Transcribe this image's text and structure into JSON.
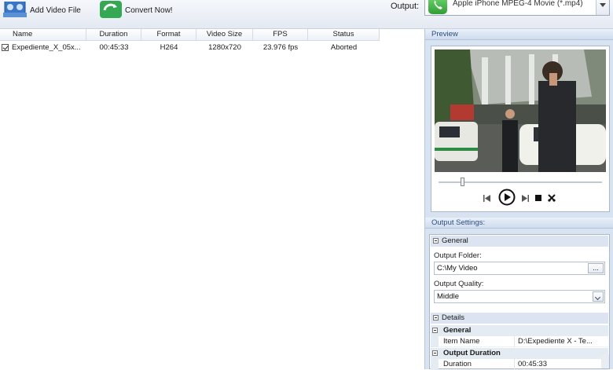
{
  "toolbar": {
    "add_video_label": "Add Video File",
    "convert_label": "Convert Now!",
    "output_label": "Output:",
    "output_value": "Apple iPhone MPEG-4 Movie (*.mp4)"
  },
  "file_list": {
    "columns": [
      "Name",
      "Duration",
      "Format",
      "Video Size",
      "FPS",
      "Status"
    ],
    "rows": [
      {
        "checked": true,
        "name": "Expediente_X_05x...",
        "duration": "00:45:33",
        "format": "H264",
        "video_size": "1280x720",
        "fps": "23.976 fps",
        "status": "Aborted"
      }
    ]
  },
  "preview": {
    "title": "Preview",
    "seek_position": 0.17
  },
  "output_settings": {
    "title": "Output Settings:",
    "general_group": "General",
    "output_folder_label": "Output Folder:",
    "output_folder_value": "C:\\My Video",
    "browse_label": "...",
    "output_quality_label": "Output Quality:",
    "output_quality_value": "Middle",
    "details_group": "Details",
    "details": {
      "general_cat": "General",
      "item_name_key": "Item Name",
      "item_name_val": "D:\\Expediente X - Te...",
      "output_duration_cat": "Output Duration",
      "duration_key": "Duration",
      "duration_val": "00:45:33"
    }
  },
  "colors": {
    "panel_bg": "#d8e3f1",
    "header_text": "#2a4d80",
    "accent_green": "#2f9d34"
  }
}
